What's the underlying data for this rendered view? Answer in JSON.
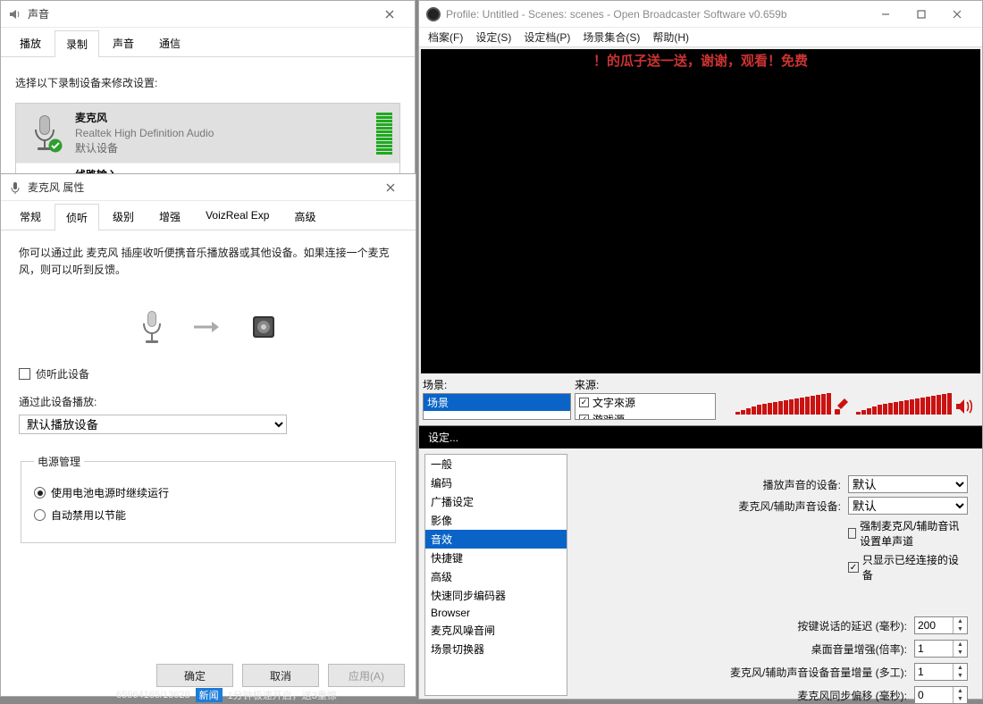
{
  "sound": {
    "title": "声音",
    "tabs": [
      "播放",
      "录制",
      "声音",
      "通信"
    ],
    "active_tab": 1,
    "instruction": "选择以下录制设备来修改设置:",
    "devices": [
      {
        "name": "麦克风",
        "driver": "Realtek High Definition Audio",
        "status": "默认设备"
      },
      {
        "name_partial": "线路输入"
      }
    ]
  },
  "mic": {
    "title": "麦克风 属性",
    "tabs": [
      "常规",
      "侦听",
      "级别",
      "增强",
      "VoizReal Exp",
      "高级"
    ],
    "active_tab": 1,
    "desc": "你可以通过此 麦克风 插座收听便携音乐播放器或其他设备。如果连接一个麦克风，则可以听到反馈。",
    "listen_checkbox": "侦听此设备",
    "playthrough_label": "通过此设备播放:",
    "playthrough_value": "默认播放设备",
    "power_group": "电源管理",
    "power_opt1": "使用电池电源时继续运行",
    "power_opt2": "自动禁用以节能",
    "btn_ok": "确定",
    "btn_cancel": "取消",
    "btn_apply": "应用(A)"
  },
  "obs": {
    "title": "Profile: Untitled - Scenes: scenes - Open Broadcaster Software v0.659b",
    "menu": [
      "档案(F)",
      "设定(S)",
      "设定档(P)",
      "场景集合(S)",
      "帮助(H)"
    ],
    "marquee": "！的瓜子送一送，谢谢，观看！免费",
    "scenes_label": "场景:",
    "scenes": [
      "场景"
    ],
    "sources_label": "来源:",
    "sources": [
      {
        "checked": true,
        "label": "文字來源"
      },
      {
        "checked": true,
        "label": "游戏源"
      }
    ],
    "settings": {
      "title": "设定...",
      "items": [
        "一般",
        "编码",
        "广播设定",
        "影像",
        "音效",
        "快捷键",
        "高级",
        "快速同步编码器",
        "Browser",
        "麦克风噪音闸",
        "场景切换器"
      ],
      "active": 4,
      "playback_label": "播放声音的设备:",
      "playback_value": "默认",
      "mic_label": "麦克风/辅助声音设备:",
      "mic_value": "默认",
      "cb_force": "强制麦克风/辅助音讯设置单声道",
      "cb_onlyconn": "只显示已经连接的设备",
      "ptt_label": "按键说话的延迟 (毫秒):",
      "ptt_value": "200",
      "deskgain_label": "桌面音量增强(倍率):",
      "deskgain_value": "1",
      "micgain_label": "麦克风/辅助声音设备音量增量 (多工):",
      "micgain_value": "1",
      "sync_label": "麦克风同步偏移 (毫秒):",
      "sync_value": "0"
    }
  },
  "taskbar": {
    "nums": "65964165/13628",
    "badge": "新闻",
    "text": "1分钟极速开启，送3重惊"
  }
}
